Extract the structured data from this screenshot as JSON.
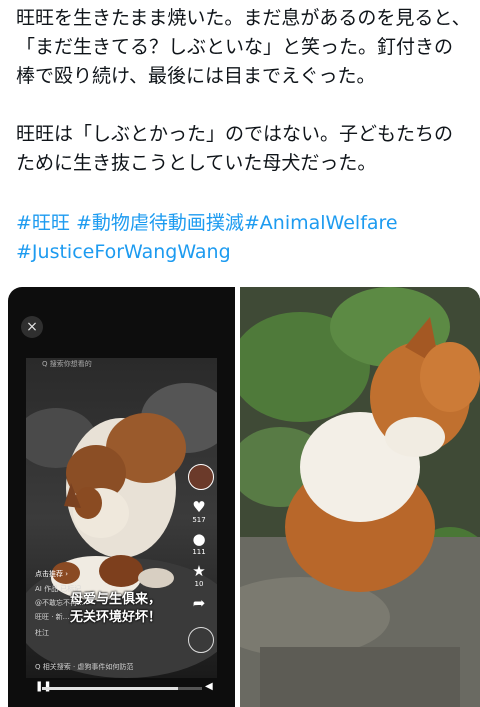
{
  "post": {
    "text": "旺旺を生きたまま焼いた。まだ息があるのを見ると、「まだ生きてる？しぶといな」と笑った。釘付きの棒で殴り続け、最後には目までえぐった。\n\n旺旺は「しぶとかった」のではない。子どもたちのために生き抜こうとしていた母犬だった。",
    "hashtags": [
      "#旺旺",
      "#動物虐待動画撲滅",
      "#AnimalWelfare",
      "#JusticeForWangWang"
    ]
  },
  "media_left": {
    "close_label": "×",
    "top_text": "Q 搜索你想看的",
    "side_counts": [
      "517",
      "111",
      "10"
    ],
    "tag_text": "点击推荐 ›",
    "caption_lines": [
      "AI 作品 已标记",
      "@不敢忘不再…",
      "旺旺 · 新…"
    ],
    "overlay_line1": "母爱与生俱来，",
    "overlay_line2": "无关环境好坏！",
    "location": "杜江",
    "search_text": "Q 相关搜索 · 虐狗事件如何防范",
    "progress_fraction": 0.85,
    "colors": {
      "accent": "#ff2d55"
    }
  },
  "media_right": {
    "description": ""
  }
}
